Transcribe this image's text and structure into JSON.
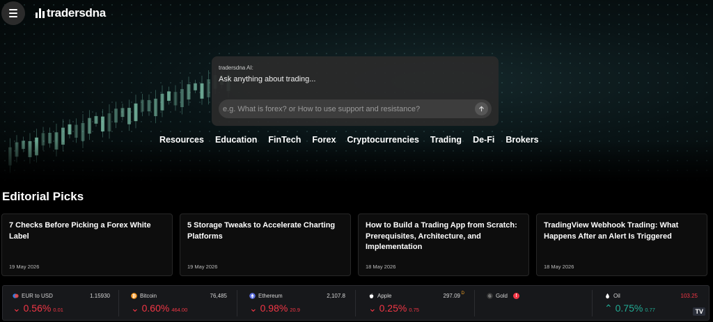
{
  "header": {
    "menu_icon": "hamburger-menu-icon",
    "logo_text": "tradersdna"
  },
  "ai_box": {
    "label": "tradersdna AI:",
    "title": "Ask anything about trading...",
    "placeholder": "e.g. What is forex? or How to use support and resistance?",
    "send_icon": "arrow-up-icon"
  },
  "nav": {
    "items": [
      "Resources",
      "Education",
      "FinTech",
      "Forex",
      "Cryptocurrencies",
      "Trading",
      "De-Fi",
      "Brokers"
    ]
  },
  "editorial": {
    "title": "Editorial Picks",
    "cards": [
      {
        "title": "7 Checks Before Picking a Forex White Label",
        "date": "19 May 2026"
      },
      {
        "title": "5 Storage Tweaks to Accelerate Charting Platforms",
        "date": "19 May 2026"
      },
      {
        "title": "How to Build a Trading App from Scratch: Prerequisites, Architecture, and Implementation",
        "date": "18 May 2026"
      },
      {
        "title": "TradingView Webhook Trading: What Happens After an Alert Is Triggered",
        "date": "18 May 2026"
      }
    ]
  },
  "ticker": {
    "items": [
      {
        "name": "EUR to USD",
        "price": "1.15930",
        "change_pct": "0.56%",
        "change_abs": "0.01",
        "direction": "down",
        "arrow": "⌄",
        "icon": "eurusd-flag-icon",
        "icon_color": "#2f7de1"
      },
      {
        "name": "Bitcoin",
        "price": "76,485",
        "change_pct": "0.60%",
        "change_abs": "464.00",
        "direction": "down",
        "arrow": "⌄",
        "icon": "bitcoin-icon",
        "icon_color": "#f7931a"
      },
      {
        "name": "Ethereum",
        "price": "2,107.8",
        "change_pct": "0.98%",
        "change_abs": "20.9",
        "direction": "down",
        "arrow": "⌄",
        "icon": "ethereum-icon",
        "icon_color": "#5b6ee1"
      },
      {
        "name": "Apple",
        "price": "297.09",
        "price_flag": "D",
        "change_pct": "0.25%",
        "change_abs": "0.75",
        "direction": "down",
        "arrow": "⌄",
        "icon": "apple-icon",
        "icon_color": "#ffffff"
      },
      {
        "name": "Gold",
        "price": "",
        "change_pct": "",
        "change_abs": "",
        "direction": "none",
        "arrow": "",
        "icon": "gold-icon",
        "icon_color": "#3a3a3a",
        "alert": "!"
      },
      {
        "name": "Oil",
        "price": "103.25",
        "change_pct": "0.75%",
        "change_abs": "0.77",
        "direction": "up",
        "arrow": "⌃",
        "icon": "oil-drop-icon",
        "icon_color": "#ffffff"
      }
    ],
    "widget_logo": "TV"
  },
  "colors": {
    "negative": "#f23645",
    "positive": "#22ab94",
    "card_bg": "#0d0d0d",
    "ticker_bg": "#17181b"
  }
}
